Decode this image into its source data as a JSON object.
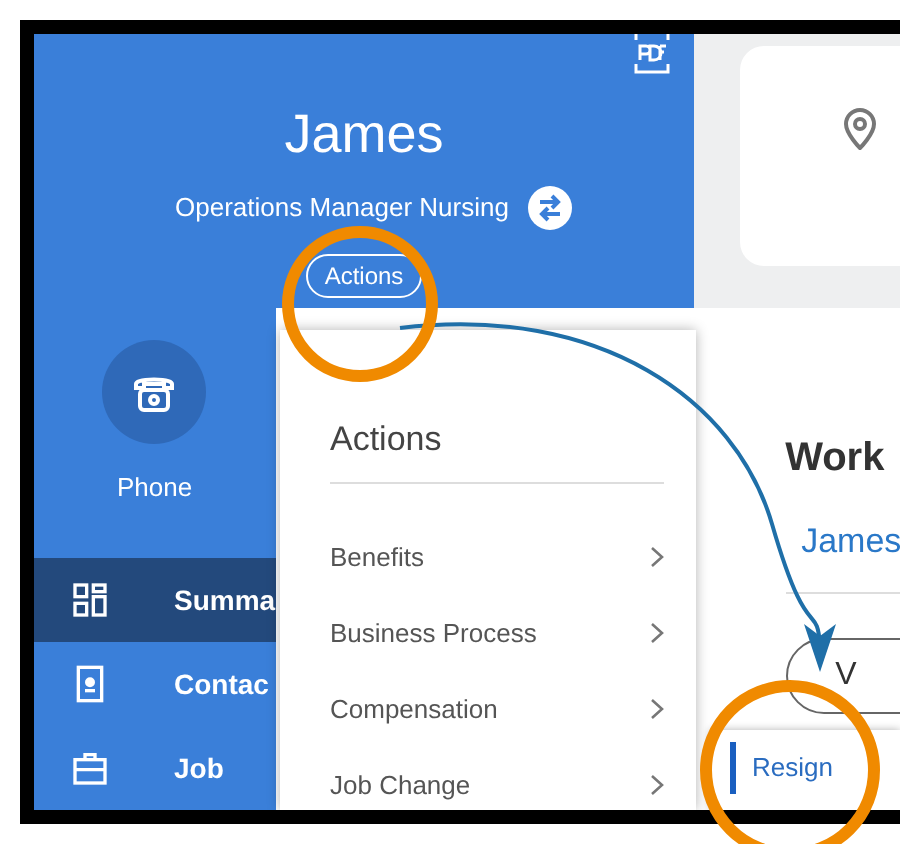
{
  "header": {
    "name": "James",
    "job_title": "Operations Manager Nursing",
    "actions_button": "Actions"
  },
  "contact": {
    "label": "Phone"
  },
  "sidebar": {
    "items": [
      {
        "label": "Summa",
        "selected": true
      },
      {
        "label": "Contac",
        "selected": false
      },
      {
        "label": "Job",
        "selected": false
      }
    ]
  },
  "main": {
    "heading": "Work",
    "link": "James",
    "button": "V"
  },
  "actions_menu": {
    "title": "Actions",
    "items": [
      {
        "label": "Benefits"
      },
      {
        "label": "Business Process"
      },
      {
        "label": "Compensation"
      },
      {
        "label": "Job Change"
      }
    ]
  },
  "submenu": {
    "items": [
      {
        "label": "Resign",
        "selected": true
      }
    ]
  }
}
